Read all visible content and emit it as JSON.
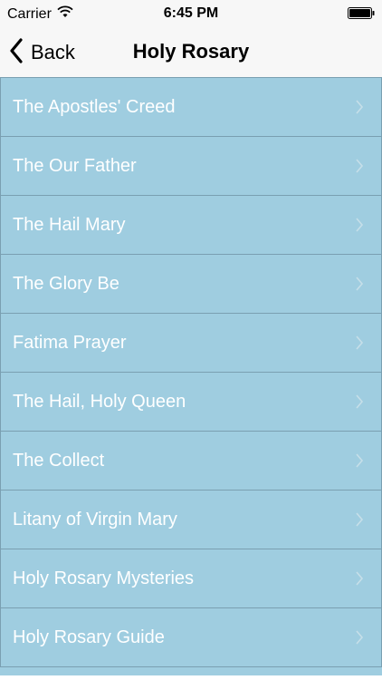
{
  "status_bar": {
    "carrier": "Carrier",
    "time": "6:45 PM",
    "wifi_icon": "wifi-icon",
    "battery_icon": "battery-icon"
  },
  "nav": {
    "back_label": "Back",
    "back_icon": "chevron-left-icon",
    "title": "Holy Rosary"
  },
  "colors": {
    "list_background": "#9fcde0",
    "list_separator": "#7a9fb1",
    "item_text": "#ffffff",
    "nav_background": "#f7f7f7"
  },
  "list": {
    "items": [
      {
        "label": "The Apostles' Creed"
      },
      {
        "label": "The Our Father"
      },
      {
        "label": "The Hail Mary"
      },
      {
        "label": "The Glory Be"
      },
      {
        "label": "Fatima Prayer"
      },
      {
        "label": "The Hail, Holy Queen"
      },
      {
        "label": "The Collect"
      },
      {
        "label": "Litany of Virgin Mary"
      },
      {
        "label": "Holy Rosary Mysteries"
      },
      {
        "label": "Holy Rosary Guide"
      }
    ],
    "item_icon": "chevron-right-icon"
  }
}
